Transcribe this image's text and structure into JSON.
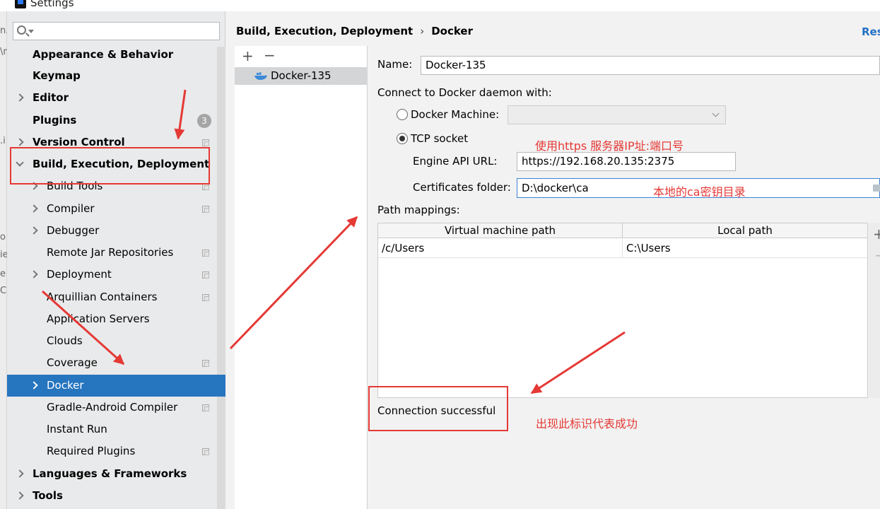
{
  "window": {
    "title": "Settings"
  },
  "left_strip": {
    "fragments": [
      "n.",
      "\\r",
      ".i",
      "o",
      "ie",
      "e",
      "Co"
    ]
  },
  "search": {
    "value": "",
    "placeholder": ""
  },
  "sidebar": {
    "items": [
      {
        "label": "Appearance & Behavior",
        "bold": true,
        "level": 0
      },
      {
        "label": "Keymap",
        "bold": true,
        "level": 0
      },
      {
        "label": "Editor",
        "bold": true,
        "level": 0,
        "chevron": "right"
      },
      {
        "label": "Plugins",
        "bold": true,
        "level": 0,
        "badge": "3"
      },
      {
        "label": "Version Control",
        "bold": true,
        "level": 0,
        "chevron": "right"
      },
      {
        "label": "Build, Execution, Deployment",
        "bold": true,
        "level": 0,
        "chevron": "down"
      },
      {
        "label": "Build Tools",
        "level": 1,
        "chevron": "right"
      },
      {
        "label": "Compiler",
        "level": 1,
        "chevron": "right"
      },
      {
        "label": "Debugger",
        "level": 1,
        "chevron": "right"
      },
      {
        "label": "Remote Jar Repositories",
        "level": 1
      },
      {
        "label": "Deployment",
        "level": 1,
        "chevron": "right"
      },
      {
        "label": "Arquillian Containers",
        "level": 1
      },
      {
        "label": "Application Servers",
        "level": 1
      },
      {
        "label": "Clouds",
        "level": 1
      },
      {
        "label": "Coverage",
        "level": 1
      },
      {
        "label": "Docker",
        "level": 1,
        "chevron": "right",
        "selected": true
      },
      {
        "label": "Gradle-Android Compiler",
        "level": 1
      },
      {
        "label": "Instant Run",
        "level": 1
      },
      {
        "label": "Required Plugins",
        "level": 1
      },
      {
        "label": "Languages & Frameworks",
        "bold": true,
        "level": 0,
        "chevron": "right"
      },
      {
        "label": "Tools",
        "bold": true,
        "level": 0,
        "chevron": "right"
      }
    ]
  },
  "header": {
    "breadcrumb_parent": "Build, Execution, Deployment",
    "breadcrumb_sep": "›",
    "breadcrumb_current": "Docker",
    "reset": "Res"
  },
  "docker_list": {
    "add": "+",
    "remove": "−",
    "items": [
      "Docker-135"
    ]
  },
  "config": {
    "name_label": "Name:",
    "name_value": "Docker-135",
    "connect_label": "Connect to Docker daemon with:",
    "docker_machine_label": "Docker Machine:",
    "docker_machine_value": "",
    "tcp_socket_label": "TCP socket",
    "engine_api_label": "Engine API URL:",
    "engine_api_value": "https://192.168.20.135:2375",
    "certs_label": "Certificates folder:",
    "certs_value": "D:\\docker\\ca",
    "path_mappings_label": "Path mappings:",
    "path_mappings": {
      "headers": [
        "Virtual machine path",
        "Local path"
      ],
      "rows": [
        [
          "/c/Users",
          "C:\\Users"
        ]
      ]
    },
    "status": "Connection successful"
  },
  "annotations": {
    "tcp_note": "使用https 服务器IP址:端口号",
    "cert_note": "本地的ca密钥目录",
    "success_note": "出现此标识代表成功",
    "color": "#e53935"
  },
  "colors": {
    "selection": "#2675bf",
    "link": "#2470c4"
  }
}
